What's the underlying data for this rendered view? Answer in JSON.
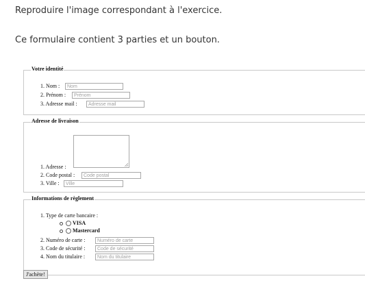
{
  "intro": {
    "line1": "Reproduire l'image correspondant à l'exercice.",
    "line2": "Ce formulaire contient 3 parties et un bouton."
  },
  "identity": {
    "legend": "Votre identité",
    "nom_label": "1. Nom :",
    "nom_placeholder": "Nom",
    "prenom_label": "2. Prénom :",
    "prenom_placeholder": "Prénom",
    "email_label": "3. Adresse mail :",
    "email_placeholder": "Adresse mail"
  },
  "delivery": {
    "legend": "Adresse de livraison",
    "address_label": "1. Adresse :",
    "postal_label": "2. Code postal :",
    "postal_placeholder": "Code postal",
    "city_label": "3. Ville :",
    "city_placeholder": "Ville"
  },
  "payment": {
    "legend": "Informations de règlement",
    "card_type_label": "1. Type de carte bancaire :",
    "card_options": [
      "VISA",
      "Mastercard"
    ],
    "card_number_label": "2. Numéro de carte :",
    "card_number_placeholder": "Numéro de carte",
    "security_label": "3. Code de sécurité :",
    "security_placeholder": "Code de sécurité",
    "holder_label": "4. Nom du titulaire :",
    "holder_placeholder": "Nom du titulaire"
  },
  "submit_label": "J'achète!"
}
